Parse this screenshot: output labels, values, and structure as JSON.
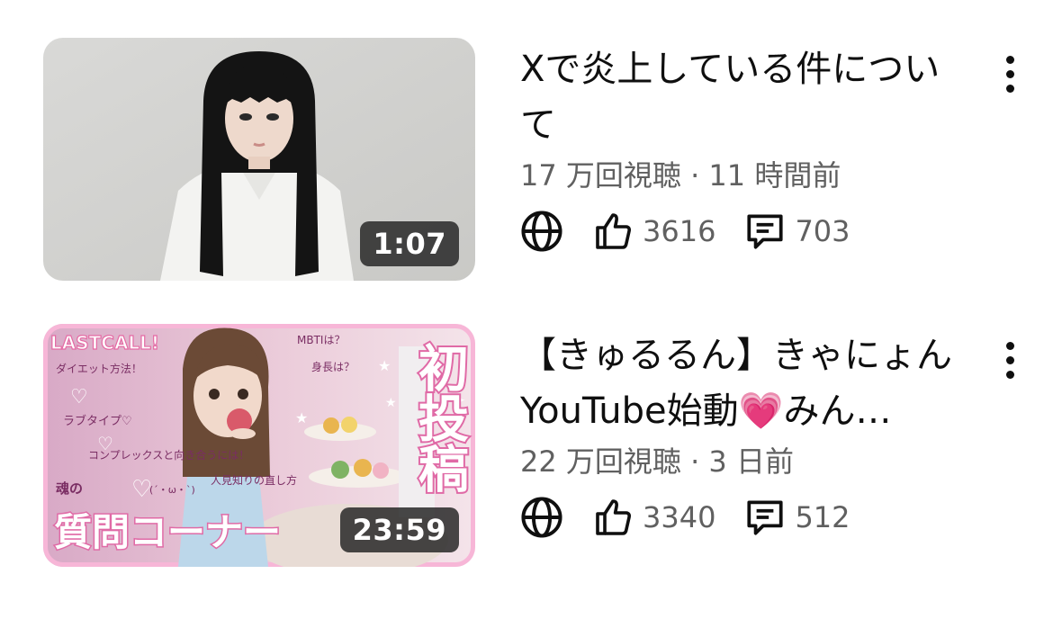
{
  "videos": [
    {
      "title": "Xで炎上している件について",
      "duration": "1:07",
      "views": "17 万回視聴",
      "age": "11 時間前",
      "likes": "3616",
      "comments": "703"
    },
    {
      "title": "【きゅるるん】きゃにょんYouTube始動💗みん…",
      "duration": "23:59",
      "views": "22 万回視聴",
      "age": "3 日前",
      "likes": "3340",
      "comments": "512",
      "thumbnail_text": {
        "lastcall": "LASTCALL!",
        "diet": "ダイエット方法！",
        "love": "ラブタイプ♡",
        "complex": "コンプレックスと向き合うには！",
        "mbti": "MBTIは？",
        "height": "身長は？",
        "tamashii": "魂の",
        "kaomoji": "(´・ω・`)",
        "hitomishiri": "人見知りの直し方",
        "corner": "質問コーナー",
        "first": "初投稿"
      }
    }
  ],
  "separator": "·",
  "icons": [
    "globe-icon",
    "thumbs-up-icon",
    "comment-icon",
    "more-vert-icon"
  ]
}
